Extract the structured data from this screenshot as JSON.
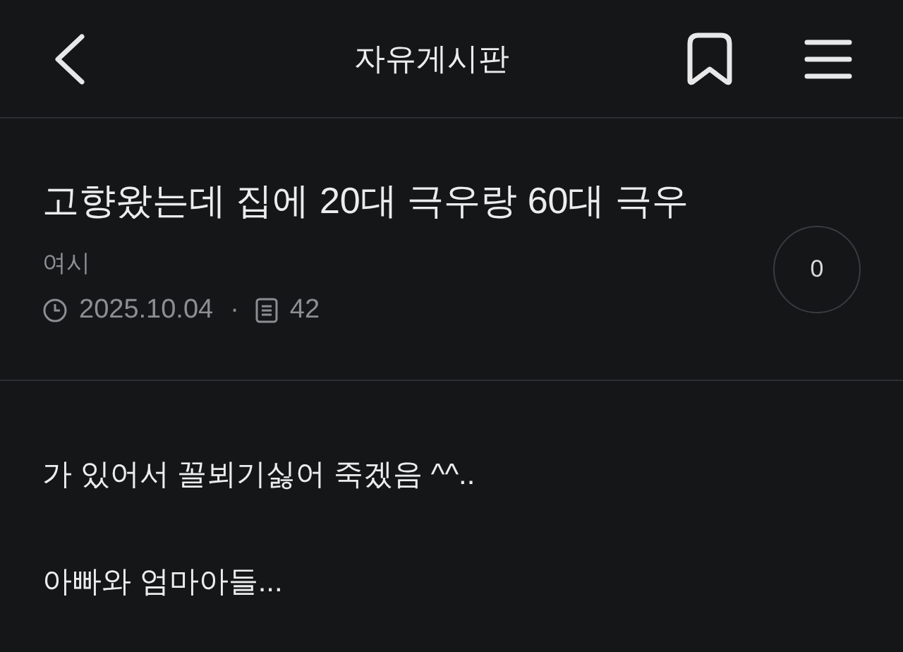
{
  "header": {
    "title": "자유게시판"
  },
  "post": {
    "title": "고향왔는데 집에 20대 극우랑 60대 극우",
    "author": "여시",
    "date": "2025.10.04",
    "separator": "·",
    "views": "42",
    "comment_count": "0"
  },
  "body": [
    "가 있어서 꼴뵈기싫어 죽겠음 ^^..",
    "아빠와 엄마아들..."
  ]
}
